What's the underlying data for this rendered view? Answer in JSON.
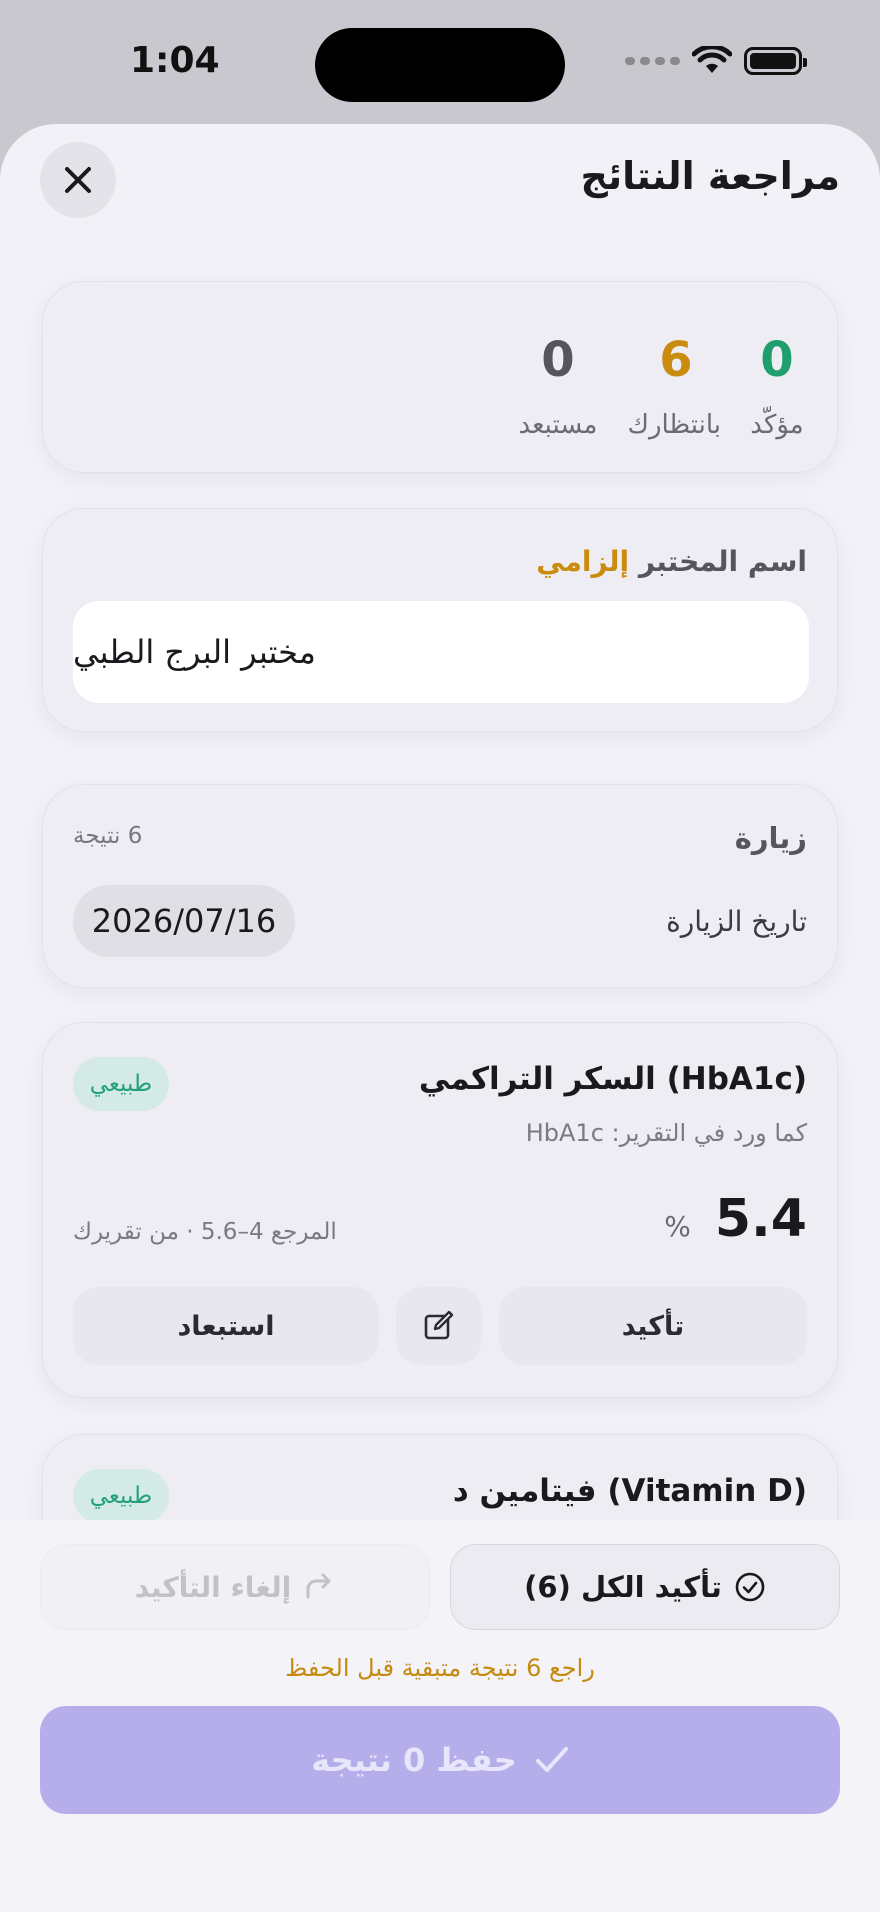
{
  "status_bar": {
    "time": "1:04"
  },
  "header": {
    "title": "مراجعة النتائج",
    "close_icon": "close-icon"
  },
  "stats": {
    "confirmed": {
      "value": "0",
      "label": "مؤكّد",
      "color": "#1f9e6e"
    },
    "pending": {
      "value": "6",
      "label": "بانتظارك",
      "color": "#c98c0f"
    },
    "rejected": {
      "value": "0",
      "label": "مستبعد",
      "color": "#55555f"
    }
  },
  "lab": {
    "label": "اسم المختبر",
    "required": "إلزامي",
    "value": "مختبر البرج الطبي"
  },
  "visit": {
    "title": "زيارة",
    "count": "6 نتيجة",
    "date_label": "تاريخ الزيارة",
    "date_value": "2026/07/16"
  },
  "results": [
    {
      "title": "السكر التراكمي (HbA1c)",
      "subtitle": "كما ورد في التقرير: HbA1c",
      "value": "5.4",
      "unit": "%",
      "reference": "المرجع 4–5.6 · من تقريرك",
      "badge": "طبيعي",
      "confirm_label": "تأكيد",
      "reject_label": "استبعاد"
    },
    {
      "title": "فيتامين د (Vitamin D)",
      "badge": "طبيعي"
    }
  ],
  "bottom": {
    "undo_label": "إلغاء التأكيد",
    "confirm_all_label": "تأكيد الكل (6)",
    "warning": "راجع 6 نتيجة متبقية قبل الحفظ",
    "save_label": "حفظ 0 نتيجة"
  }
}
